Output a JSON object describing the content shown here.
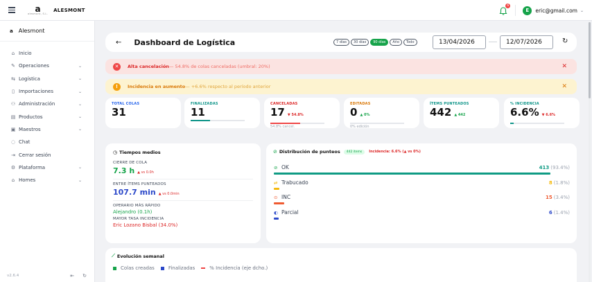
{
  "topbar": {
    "logo_mark": "a",
    "logo_sub": "alesmont, S.L.",
    "brand": "ALESMONT",
    "notification_count": "6",
    "user_initial": "E",
    "user_email": "eric@gmail.com"
  },
  "sidebar": {
    "header_mini": "a",
    "header_name": "Alesmont",
    "items": [
      {
        "label": "Inicio",
        "icon": "home-icon"
      },
      {
        "label": "Operaciones",
        "icon": "wrench-icon"
      },
      {
        "label": "Logística",
        "icon": "route-icon"
      },
      {
        "label": "Importaciones",
        "icon": "file-icon"
      },
      {
        "label": "Administración",
        "icon": "users-icon"
      },
      {
        "label": "Productos",
        "icon": "box-icon"
      },
      {
        "label": "Maestros",
        "icon": "book-icon"
      },
      {
        "label": "Chat",
        "icon": "chat-icon"
      },
      {
        "label": "Cerrar sesión",
        "icon": "logout-icon"
      },
      {
        "label": "Plataforma",
        "icon": "gear-icon"
      },
      {
        "label": "Homes",
        "icon": "home-icon"
      }
    ],
    "version": "v2.6.4"
  },
  "header": {
    "title": "Dashboard de Logística",
    "ranges": [
      "7 días",
      "30 días",
      "90 días",
      "Año",
      "Todo"
    ],
    "active_range": "90 días",
    "date_from": "13/04/2026",
    "date_to": "12/07/2026"
  },
  "alerts": {
    "red": {
      "title": "Alta cancelación",
      "detail": " — 54.8% de colas canceladas (umbral: 20%)"
    },
    "yellow": {
      "title": "Incidencia en aumento",
      "detail": " — +6.6% respecto al período anterior"
    }
  },
  "kpis": {
    "total": {
      "label": "TOTAL COLAS",
      "value": "31"
    },
    "finalizadas": {
      "label": "FINALIZADAS",
      "value": "11",
      "progress": 0.355
    },
    "canceladas": {
      "label": "CANCELADAS",
      "value": "17",
      "trend": "▼ 54.8%",
      "sub": "54.8% cancel.",
      "progress": 0.548
    },
    "editadas": {
      "label": "EDITADAS",
      "value": "0",
      "trend": "▲ 0%",
      "sub": "0% edición"
    },
    "items": {
      "label": "ÍTEMS PUNTEADOS",
      "value": "442",
      "trend": "▲ 442"
    },
    "incidencia": {
      "label": "% INCIDENCIA",
      "value": "6.6%",
      "trend": "▼ 6.6%",
      "progress": 0.066
    }
  },
  "tiempos": {
    "title": "Tiempos medios",
    "cierre_label": "CIERRE DE COLA",
    "cierre_value": "7.3 h",
    "cierre_trend": "▲ vs 0.0h",
    "entre_label": "ENTRE ÍTEMS PUNTEADOS",
    "entre_value": "107.7 min",
    "entre_trend": "▲ vs 0.0min",
    "rapido_label": "OPERARIO MÁS RÁPIDO",
    "rapido_value": "Alejandro (0.1h)",
    "mayor_label": "MAYOR TASA INCIDENCIA",
    "mayor_value": "Eric Lozano Bisbal (34.0%)"
  },
  "distribucion": {
    "title": "Distribución de punteos",
    "pill": "442 items",
    "incidencia": "Incidencia: 6.6% (▲ vs 0%)",
    "rows": [
      {
        "name": "OK",
        "count": "413",
        "pct": "(93.4%)",
        "share": 0.934,
        "color": "#0f9b84",
        "icon": "check-circle-icon"
      },
      {
        "name": "Trabucado",
        "count": "8",
        "pct": "(1.8%)",
        "share": 0.018,
        "color": "#f5b90b",
        "icon": "shuffle-icon"
      },
      {
        "name": "INC",
        "count": "15",
        "pct": "(3.4%)",
        "share": 0.034,
        "color": "#ef5a30",
        "icon": "alert-circle-icon"
      },
      {
        "name": "Parcial",
        "count": "6",
        "pct": "(1.4%)",
        "share": 0.014,
        "color": "#2b48c9",
        "icon": "half-circle-icon"
      }
    ]
  },
  "semanal": {
    "title": "Evolución semanal",
    "legend": [
      "Colas creadas",
      "Finalizadas",
      "% Incidencia (eje dcho.)"
    ]
  },
  "colors": {
    "green": "#16a34a",
    "teal": "#0d9488",
    "red": "#dc2626",
    "blue": "#2563eb",
    "amber": "#d97706"
  }
}
